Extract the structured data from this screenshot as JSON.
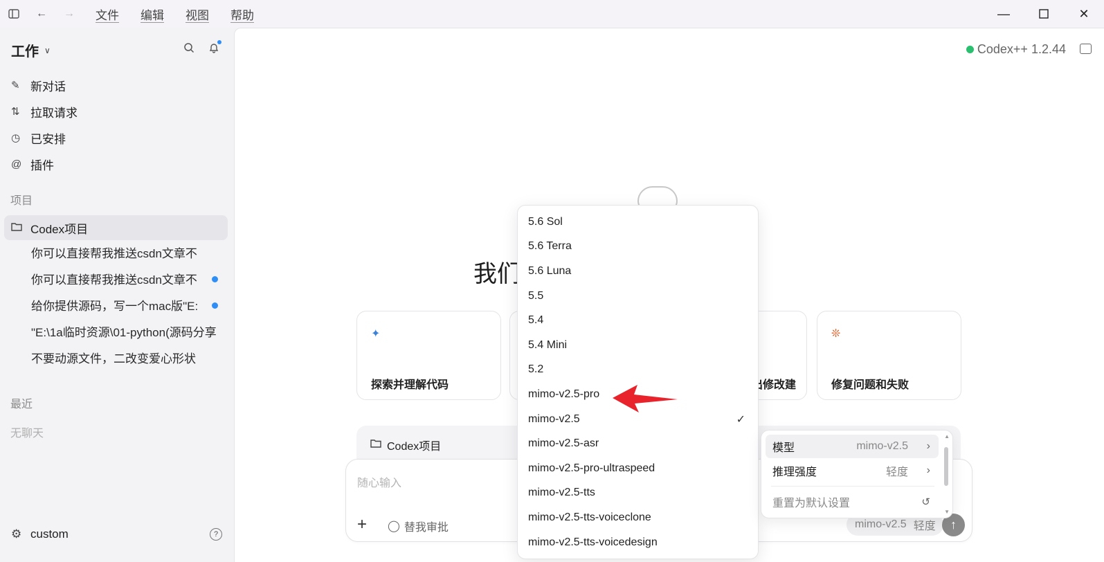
{
  "titlebar": {
    "menu": [
      "文件",
      "编辑",
      "视图",
      "帮助"
    ]
  },
  "sidebar": {
    "workspace": "工作",
    "nav": [
      "新对话",
      "拉取请求",
      "已安排",
      "插件"
    ],
    "projects_label": "项目",
    "project_name": "Codex项目",
    "threads": [
      {
        "title": "你可以直接帮我推送csdn文章不",
        "unread": false
      },
      {
        "title": "你可以直接帮我推送csdn文章不",
        "unread": true
      },
      {
        "title": "给你提供源码，写一个mac版\"E:",
        "unread": true
      },
      {
        "title": "\"E:\\1a临时资源\\01-python(源码分享",
        "unread": false
      },
      {
        "title": "不要动源文件，二改变爱心形状",
        "unread": false
      }
    ],
    "recent_label": "最近",
    "empty_recent": "无聊天",
    "account": "custom"
  },
  "main": {
    "version": "Codex++ 1.2.44",
    "headline": "我们                                         些什么?",
    "cards": [
      {
        "title": "探索并理解代码"
      },
      {
        "title": ""
      },
      {
        "title": "出修改建"
      },
      {
        "title": "修复问题和失败"
      }
    ],
    "context_project": "Codex项目",
    "composer": {
      "placeholder": "随心输入",
      "approve_label": "替我审批",
      "model": "mimo-v2.5",
      "effort": "轻度"
    }
  },
  "model_dropdown": {
    "options": [
      "5.6 Sol",
      "5.6 Terra",
      "5.6 Luna",
      "5.5",
      "5.4",
      "5.4 Mini",
      "5.2",
      "mimo-v2.5-pro",
      "mimo-v2.5",
      "mimo-v2.5-asr",
      "mimo-v2.5-pro-ultraspeed",
      "mimo-v2.5-tts",
      "mimo-v2.5-tts-voiceclone",
      "mimo-v2.5-tts-voicedesign"
    ],
    "selected": "mimo-v2.5",
    "highlighted_by_arrow": "mimo-v2.5-pro"
  },
  "settings_menu": {
    "model_label": "模型",
    "model_value": "mimo-v2.5",
    "effort_label": "推理强度",
    "effort_value": "轻度",
    "reset_label": "重置为默认设置"
  },
  "colors": {
    "accent_blue": "#2f8ef5",
    "status_green": "#2ac06f",
    "annotation_red": "#e8232b",
    "bug_orange": "#e0622a",
    "telescope_blue": "#3b82d6"
  }
}
